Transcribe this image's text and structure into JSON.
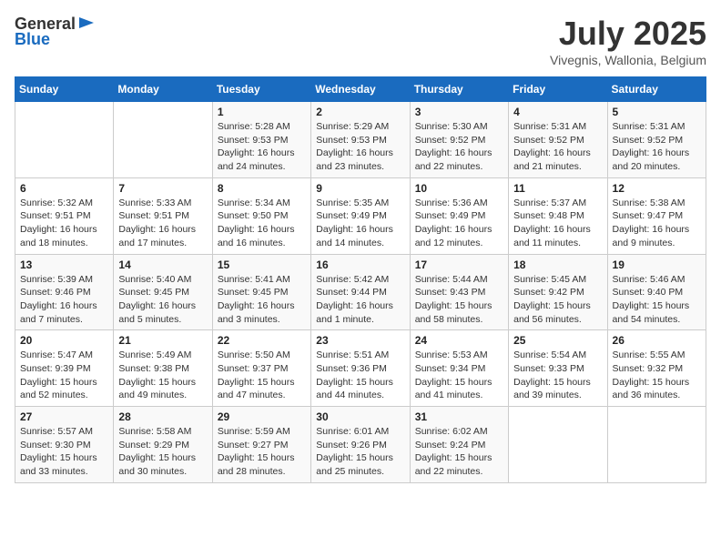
{
  "header": {
    "logo_general": "General",
    "logo_blue": "Blue",
    "month_year": "July 2025",
    "location": "Vivegnis, Wallonia, Belgium"
  },
  "calendar": {
    "days_of_week": [
      "Sunday",
      "Monday",
      "Tuesday",
      "Wednesday",
      "Thursday",
      "Friday",
      "Saturday"
    ],
    "weeks": [
      [
        {
          "day": "",
          "info": ""
        },
        {
          "day": "",
          "info": ""
        },
        {
          "day": "1",
          "info": "Sunrise: 5:28 AM\nSunset: 9:53 PM\nDaylight: 16 hours and 24 minutes."
        },
        {
          "day": "2",
          "info": "Sunrise: 5:29 AM\nSunset: 9:53 PM\nDaylight: 16 hours and 23 minutes."
        },
        {
          "day": "3",
          "info": "Sunrise: 5:30 AM\nSunset: 9:52 PM\nDaylight: 16 hours and 22 minutes."
        },
        {
          "day": "4",
          "info": "Sunrise: 5:31 AM\nSunset: 9:52 PM\nDaylight: 16 hours and 21 minutes."
        },
        {
          "day": "5",
          "info": "Sunrise: 5:31 AM\nSunset: 9:52 PM\nDaylight: 16 hours and 20 minutes."
        }
      ],
      [
        {
          "day": "6",
          "info": "Sunrise: 5:32 AM\nSunset: 9:51 PM\nDaylight: 16 hours and 18 minutes."
        },
        {
          "day": "7",
          "info": "Sunrise: 5:33 AM\nSunset: 9:51 PM\nDaylight: 16 hours and 17 minutes."
        },
        {
          "day": "8",
          "info": "Sunrise: 5:34 AM\nSunset: 9:50 PM\nDaylight: 16 hours and 16 minutes."
        },
        {
          "day": "9",
          "info": "Sunrise: 5:35 AM\nSunset: 9:49 PM\nDaylight: 16 hours and 14 minutes."
        },
        {
          "day": "10",
          "info": "Sunrise: 5:36 AM\nSunset: 9:49 PM\nDaylight: 16 hours and 12 minutes."
        },
        {
          "day": "11",
          "info": "Sunrise: 5:37 AM\nSunset: 9:48 PM\nDaylight: 16 hours and 11 minutes."
        },
        {
          "day": "12",
          "info": "Sunrise: 5:38 AM\nSunset: 9:47 PM\nDaylight: 16 hours and 9 minutes."
        }
      ],
      [
        {
          "day": "13",
          "info": "Sunrise: 5:39 AM\nSunset: 9:46 PM\nDaylight: 16 hours and 7 minutes."
        },
        {
          "day": "14",
          "info": "Sunrise: 5:40 AM\nSunset: 9:45 PM\nDaylight: 16 hours and 5 minutes."
        },
        {
          "day": "15",
          "info": "Sunrise: 5:41 AM\nSunset: 9:45 PM\nDaylight: 16 hours and 3 minutes."
        },
        {
          "day": "16",
          "info": "Sunrise: 5:42 AM\nSunset: 9:44 PM\nDaylight: 16 hours and 1 minute."
        },
        {
          "day": "17",
          "info": "Sunrise: 5:44 AM\nSunset: 9:43 PM\nDaylight: 15 hours and 58 minutes."
        },
        {
          "day": "18",
          "info": "Sunrise: 5:45 AM\nSunset: 9:42 PM\nDaylight: 15 hours and 56 minutes."
        },
        {
          "day": "19",
          "info": "Sunrise: 5:46 AM\nSunset: 9:40 PM\nDaylight: 15 hours and 54 minutes."
        }
      ],
      [
        {
          "day": "20",
          "info": "Sunrise: 5:47 AM\nSunset: 9:39 PM\nDaylight: 15 hours and 52 minutes."
        },
        {
          "day": "21",
          "info": "Sunrise: 5:49 AM\nSunset: 9:38 PM\nDaylight: 15 hours and 49 minutes."
        },
        {
          "day": "22",
          "info": "Sunrise: 5:50 AM\nSunset: 9:37 PM\nDaylight: 15 hours and 47 minutes."
        },
        {
          "day": "23",
          "info": "Sunrise: 5:51 AM\nSunset: 9:36 PM\nDaylight: 15 hours and 44 minutes."
        },
        {
          "day": "24",
          "info": "Sunrise: 5:53 AM\nSunset: 9:34 PM\nDaylight: 15 hours and 41 minutes."
        },
        {
          "day": "25",
          "info": "Sunrise: 5:54 AM\nSunset: 9:33 PM\nDaylight: 15 hours and 39 minutes."
        },
        {
          "day": "26",
          "info": "Sunrise: 5:55 AM\nSunset: 9:32 PM\nDaylight: 15 hours and 36 minutes."
        }
      ],
      [
        {
          "day": "27",
          "info": "Sunrise: 5:57 AM\nSunset: 9:30 PM\nDaylight: 15 hours and 33 minutes."
        },
        {
          "day": "28",
          "info": "Sunrise: 5:58 AM\nSunset: 9:29 PM\nDaylight: 15 hours and 30 minutes."
        },
        {
          "day": "29",
          "info": "Sunrise: 5:59 AM\nSunset: 9:27 PM\nDaylight: 15 hours and 28 minutes."
        },
        {
          "day": "30",
          "info": "Sunrise: 6:01 AM\nSunset: 9:26 PM\nDaylight: 15 hours and 25 minutes."
        },
        {
          "day": "31",
          "info": "Sunrise: 6:02 AM\nSunset: 9:24 PM\nDaylight: 15 hours and 22 minutes."
        },
        {
          "day": "",
          "info": ""
        },
        {
          "day": "",
          "info": ""
        }
      ]
    ]
  }
}
